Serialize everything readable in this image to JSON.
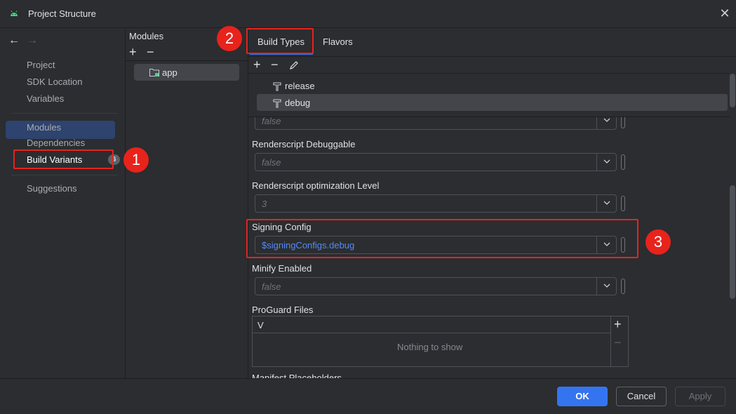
{
  "window": {
    "title": "Project Structure",
    "close_icon": "close-icon"
  },
  "nav": {
    "back_icon": "arrow-left-icon",
    "forward_icon": "arrow-right-icon",
    "items": [
      {
        "label": "Project"
      },
      {
        "label": "SDK Location"
      },
      {
        "label": "Variables"
      },
      {
        "label": "Modules"
      },
      {
        "label": "Dependencies"
      },
      {
        "label": "Build Variants",
        "selected": true
      },
      {
        "label": "Suggestions",
        "badge": "6"
      }
    ]
  },
  "modules": {
    "header": "Modules",
    "add_icon": "plus-icon",
    "remove_icon": "minus-icon",
    "items": [
      {
        "label": "app",
        "icon": "module-folder-icon"
      }
    ]
  },
  "tabs": [
    {
      "label": "Build Types",
      "active": true
    },
    {
      "label": "Flavors"
    }
  ],
  "build_types": {
    "toolbar": {
      "add": "plus-icon",
      "remove": "minus-icon",
      "edit": "pencil-icon"
    },
    "items": [
      {
        "label": "release",
        "icon": "hammer-icon"
      },
      {
        "label": "debug",
        "icon": "hammer-icon",
        "selected": true
      }
    ]
  },
  "properties": {
    "partial_value": "false",
    "renderscript_debuggable": {
      "label": "Renderscript Debuggable",
      "value": "false"
    },
    "renderscript_opt": {
      "label": "Renderscript optimization Level",
      "value": "3"
    },
    "signing_config": {
      "label": "Signing Config",
      "value": "$signingConfigs.debug"
    },
    "minify_enabled": {
      "label": "Minify Enabled",
      "value": "false"
    },
    "proguard": {
      "label": "ProGuard Files",
      "column": "V",
      "empty": "Nothing to show",
      "add_icon": "plus-icon",
      "remove_icon": "minus-icon"
    },
    "cut_label": "Manifest Placeholders"
  },
  "footer": {
    "ok": "OK",
    "cancel": "Cancel",
    "apply": "Apply"
  },
  "annotations": [
    "1",
    "2",
    "3"
  ],
  "colors": {
    "accent": "#3574f0",
    "annotation_red": "#e8231c",
    "background": "#2b2d30"
  }
}
